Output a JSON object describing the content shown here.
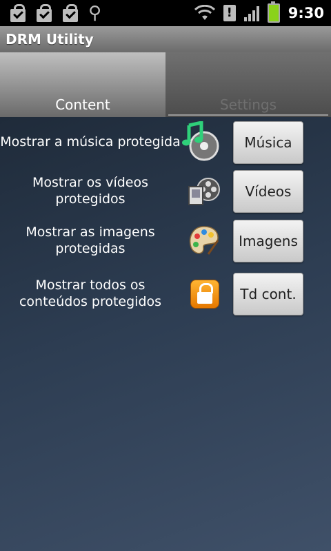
{
  "status_bar": {
    "time": "9:30",
    "icons": [
      "shopping-bag-check-icon",
      "shopping-bag-check-icon",
      "shopping-bag-check-icon",
      "usb-icon",
      "wifi-icon",
      "warning-icon",
      "signal-icon",
      "battery-charging-icon"
    ]
  },
  "title_bar": {
    "title": "DRM Utility"
  },
  "tabs": [
    {
      "label": "Content",
      "selected": true
    },
    {
      "label": "Settings",
      "selected": false
    }
  ],
  "rows": [
    {
      "description": "Mostrar a música protegida",
      "icon": "music-disc-icon",
      "button_label": "Música"
    },
    {
      "description": "Mostrar os vídeos protegidos",
      "icon": "video-film-icon",
      "button_label": "Vídeos"
    },
    {
      "description": "Mostrar as imagens protegidas",
      "icon": "paint-palette-icon",
      "button_label": "Imagens"
    },
    {
      "description": "Mostrar todos os conteúdos protegidos",
      "icon": "lock-icon",
      "button_label": "Td cont."
    }
  ],
  "colors": {
    "battery": "#8ad21a",
    "lock_icon": "#f39a1d",
    "music_note": "#2fd07a"
  }
}
